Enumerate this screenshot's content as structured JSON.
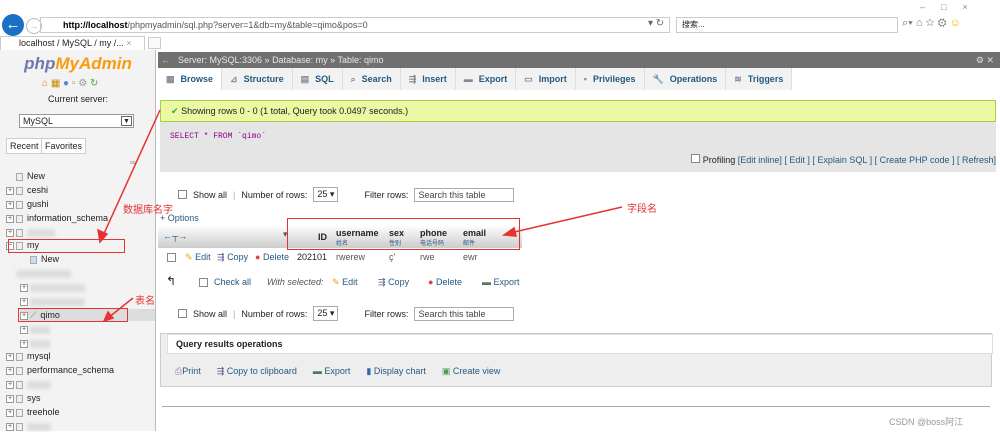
{
  "browser": {
    "url_host": "http://localhost",
    "url_rest": "/phpmyadmin/sql.php?server=1&db=my&table=qimo&pos=0",
    "search_placeholder": "搜索...",
    "tab_title": "localhost / MySQL / my /...",
    "tab_close": "×"
  },
  "sidebar": {
    "logo_php": "php",
    "logo_admin": "MyAdmin",
    "current_server_label": "Current server:",
    "server_select": "MySQL",
    "recent": "Recent",
    "favorites": "Favorites",
    "tree": [
      "New",
      "ceshi",
      "gushi",
      "information_schema",
      "my",
      "New",
      "qimo",
      "mysql",
      "performance_schema",
      "sys",
      "treehole"
    ]
  },
  "breadcrumb": {
    "server": "Server: MySQL:3306",
    "database": "Database: my",
    "table": "Table: qimo"
  },
  "tabs": [
    "Browse",
    "Structure",
    "SQL",
    "Search",
    "Insert",
    "Export",
    "Import",
    "Privileges",
    "Operations",
    "Triggers"
  ],
  "message": "Showing rows 0 - 0 (1 total, Query took 0.0497 seconds.)",
  "sql": "SELECT * FROM `qimo`",
  "profiling": {
    "label": "Profiling",
    "links": [
      "[Edit inline]",
      "[ Edit ]",
      "[ Explain SQL ]",
      "[ Create PHP code ]",
      "[ Refresh]"
    ]
  },
  "nav": {
    "show_all": "Show all",
    "rows_label": "Number of rows:",
    "rows_value": "25",
    "filter_label": "Filter rows:",
    "filter_placeholder": "Search this table"
  },
  "options": "+ Options",
  "columns": [
    {
      "name": "ID",
      "comment": ""
    },
    {
      "name": "username",
      "comment": "姓名"
    },
    {
      "name": "sex",
      "comment": "性别"
    },
    {
      "name": "phone",
      "comment": "电话号码"
    },
    {
      "name": "email",
      "comment": "邮件"
    }
  ],
  "row_actions": {
    "edit": "Edit",
    "copy": "Copy",
    "delete": "Delete"
  },
  "rows": [
    [
      "202101",
      "rwerew",
      "ç'",
      "rwe",
      "ewr"
    ]
  ],
  "bulk": {
    "check_all": "Check all",
    "with_selected": "With selected:",
    "edit": "Edit",
    "copy": "Copy",
    "delete": "Delete",
    "export": "Export"
  },
  "qro": {
    "title": "Query results operations",
    "print": "Print",
    "copy": "Copy to clipboard",
    "export": "Export",
    "chart": "Display chart",
    "view": "Create view"
  },
  "annotations": {
    "db": "数据库名字",
    "table": "表名",
    "fields": "字段名"
  },
  "watermark": "CSDN @boss阿江"
}
